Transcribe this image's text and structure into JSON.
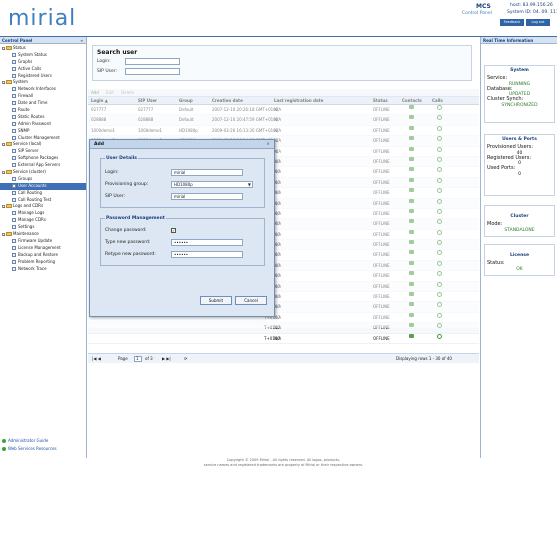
{
  "header": {
    "logo": "mirial",
    "product": "MCS",
    "subtitle": "Control Panel",
    "host": "host: 83.99.156.26 ",
    "system_id": "System ID: 04. 09. 1111",
    "buttons": [
      "Feedback",
      "Log out"
    ]
  },
  "left_panel": {
    "title": "Control Panel",
    "close": "«",
    "tree": [
      {
        "type": "folder",
        "label": "Status"
      },
      {
        "type": "leaf",
        "label": "System Status"
      },
      {
        "type": "leaf",
        "label": "Graphs"
      },
      {
        "type": "leaf",
        "label": "Active Calls"
      },
      {
        "type": "leaf",
        "label": "Registered Users"
      },
      {
        "type": "folder",
        "label": "System"
      },
      {
        "type": "leaf",
        "label": "Network Interfaces"
      },
      {
        "type": "leaf",
        "label": "Firewall"
      },
      {
        "type": "leaf",
        "label": "Date and Time"
      },
      {
        "type": "leaf",
        "label": "Route"
      },
      {
        "type": "leaf",
        "label": "Static Routes"
      },
      {
        "type": "leaf",
        "label": "Admin Password"
      },
      {
        "type": "leaf",
        "label": "SNMP"
      },
      {
        "type": "leaf",
        "label": "Cluster Management"
      },
      {
        "type": "folder",
        "label": "Service (local)"
      },
      {
        "type": "leaf",
        "label": "SIP Server"
      },
      {
        "type": "leaf",
        "label": "Softphone Packages"
      },
      {
        "type": "leaf",
        "label": "External App Servers"
      },
      {
        "type": "folder",
        "label": "Service (cluster)"
      },
      {
        "type": "leaf",
        "label": "Groups"
      },
      {
        "type": "leaf",
        "label": "User Accounts",
        "selected": true
      },
      {
        "type": "leaf",
        "label": "Call Routing"
      },
      {
        "type": "leaf",
        "label": "Call Routing Test"
      },
      {
        "type": "folder",
        "label": "Logs and CDRs"
      },
      {
        "type": "leaf",
        "label": "Manage Logs"
      },
      {
        "type": "leaf",
        "label": "Manage CDRs"
      },
      {
        "type": "leaf",
        "label": "Settings"
      },
      {
        "type": "folder",
        "label": "Maintenance"
      },
      {
        "type": "leaf",
        "label": "Firmware Update"
      },
      {
        "type": "leaf",
        "label": "License Management"
      },
      {
        "type": "leaf",
        "label": "Backup and Restore"
      },
      {
        "type": "leaf",
        "label": "Problem Reporting"
      },
      {
        "type": "leaf",
        "label": "Network Trace"
      }
    ],
    "links": [
      "Administrator Guide",
      "Web Services Resources"
    ]
  },
  "search": {
    "title": "Search user",
    "login_label": "Login:",
    "sip_label": "SIP User:"
  },
  "toolbar": {
    "add": "Add",
    "edit": "Edit",
    "delete": "Delete"
  },
  "grid": {
    "columns": [
      "Login ▲",
      "SIP User",
      "Group",
      "Creation date",
      "Last registration date",
      "Status",
      "Contacts",
      "Calls"
    ],
    "rows": [
      [
        "027777",
        "027777",
        "Default",
        "2007-12-10 20:26:18 GMT+0100",
        "N/A",
        "OFFLINE"
      ],
      [
        "028888",
        "028888",
        "Default",
        "2007-12-10 20:47:59 GMT+0100",
        "N/A",
        "OFFLINE"
      ],
      [
        "1000demo1",
        "1000demo1",
        "HD1080p",
        "2009-03-26 16:13:30 GMT+0100",
        "N/A",
        "OFFLINE"
      ],
      [
        "1000demo2",
        "1000demo2",
        "HD1080p",
        "2009-03-26 16:14:00 GMT+0100",
        "N/A",
        "OFFLINE"
      ],
      [
        "1000demo3",
        "1000demo3",
        "HD1080p",
        "2009-03-26 16:14:31 GMT+0100",
        "N/A",
        "OFFLINE"
      ],
      [
        "",
        "",
        "",
        "T+0100",
        "N/A",
        "OFFLINE"
      ],
      [
        "",
        "",
        "",
        "T+0100",
        "N/A",
        "OFFLINE"
      ],
      [
        "",
        "",
        "",
        "T+0100",
        "N/A",
        "OFFLINE"
      ],
      [
        "",
        "",
        "",
        "T+0100",
        "N/A",
        "OFFLINE"
      ],
      [
        "",
        "",
        "",
        "T+0100",
        "N/A",
        "OFFLINE"
      ],
      [
        "",
        "",
        "",
        "T+0100",
        "N/A",
        "OFFLINE"
      ],
      [
        "",
        "",
        "",
        "T+0100",
        "N/A",
        "OFFLINE"
      ],
      [
        "",
        "",
        "",
        "T+0100",
        "N/A",
        "OFFLINE"
      ],
      [
        "",
        "",
        "",
        "T+0100",
        "N/A",
        "OFFLINE"
      ],
      [
        "",
        "",
        "",
        "T+0100",
        "N/A",
        "OFFLINE"
      ],
      [
        "",
        "",
        "",
        "T+0100",
        "N/A",
        "OFFLINE"
      ],
      [
        "",
        "",
        "",
        "T+0100",
        "N/A",
        "OFFLINE"
      ],
      [
        "",
        "",
        "",
        "T+0100",
        "N/A",
        "OFFLINE"
      ],
      [
        "",
        "",
        "",
        "T+0100",
        "N/A",
        "OFFLINE"
      ],
      [
        "",
        "",
        "",
        "T+0100",
        "N/A",
        "OFFLINE"
      ],
      [
        "",
        "",
        "",
        "T+0100",
        "N/A",
        "OFFLINE"
      ],
      [
        "",
        "",
        "",
        "T+0100",
        "N/A",
        "OFFLINE"
      ],
      [
        "",
        "",
        "",
        "T+0100",
        "N/A",
        "OFFLINE"
      ]
    ]
  },
  "pager": {
    "page_label": "Page",
    "page": "1",
    "of": "of 3",
    "summary": "Displaying rows 1 - 30 of 40"
  },
  "modal": {
    "title": "Add",
    "close": "×",
    "user_details": "User Details",
    "login_label": "Login:",
    "login_value": "mirial",
    "group_label": "Provisioning group:",
    "group_value": "HD1080p",
    "sip_label": "SIP User:",
    "sip_value": "mirial",
    "pw_mgmt": "Password Management",
    "change_label": "Change password:",
    "change_checked": "✓",
    "new_label": "Type new password:",
    "new_value": "••••••",
    "retype_label": "Retype new password:",
    "retype_value": "••••••",
    "submit": "Submit",
    "cancel": "Cancel"
  },
  "right_panel": {
    "title": "Real Time Information",
    "system": {
      "title": "System",
      "service_label": "Service:",
      "service": "RUNNING",
      "db_label": "Database:",
      "db": "UPDATED",
      "cluster_label": "Cluster Synch:",
      "cluster": "SYNCHRONIZED"
    },
    "users": {
      "title": "Users & Ports",
      "prov_label": "Provisioned Users:",
      "prov": "40",
      "reg_label": "Registered Users:",
      "reg": "0",
      "ports_label": "Used Ports:",
      "ports": "0"
    },
    "cluster": {
      "title": "Cluster",
      "mode_label": "Mode:",
      "mode": "STANDALONE"
    },
    "license": {
      "title": "License",
      "status_label": "Status:",
      "status": "OK"
    }
  },
  "footer": {
    "line1": "Copyright © 2009 Mirial - All rights reserved. All logos, products,",
    "line2": "service names and registered trademarks are property of Mirial or their respective owners."
  }
}
